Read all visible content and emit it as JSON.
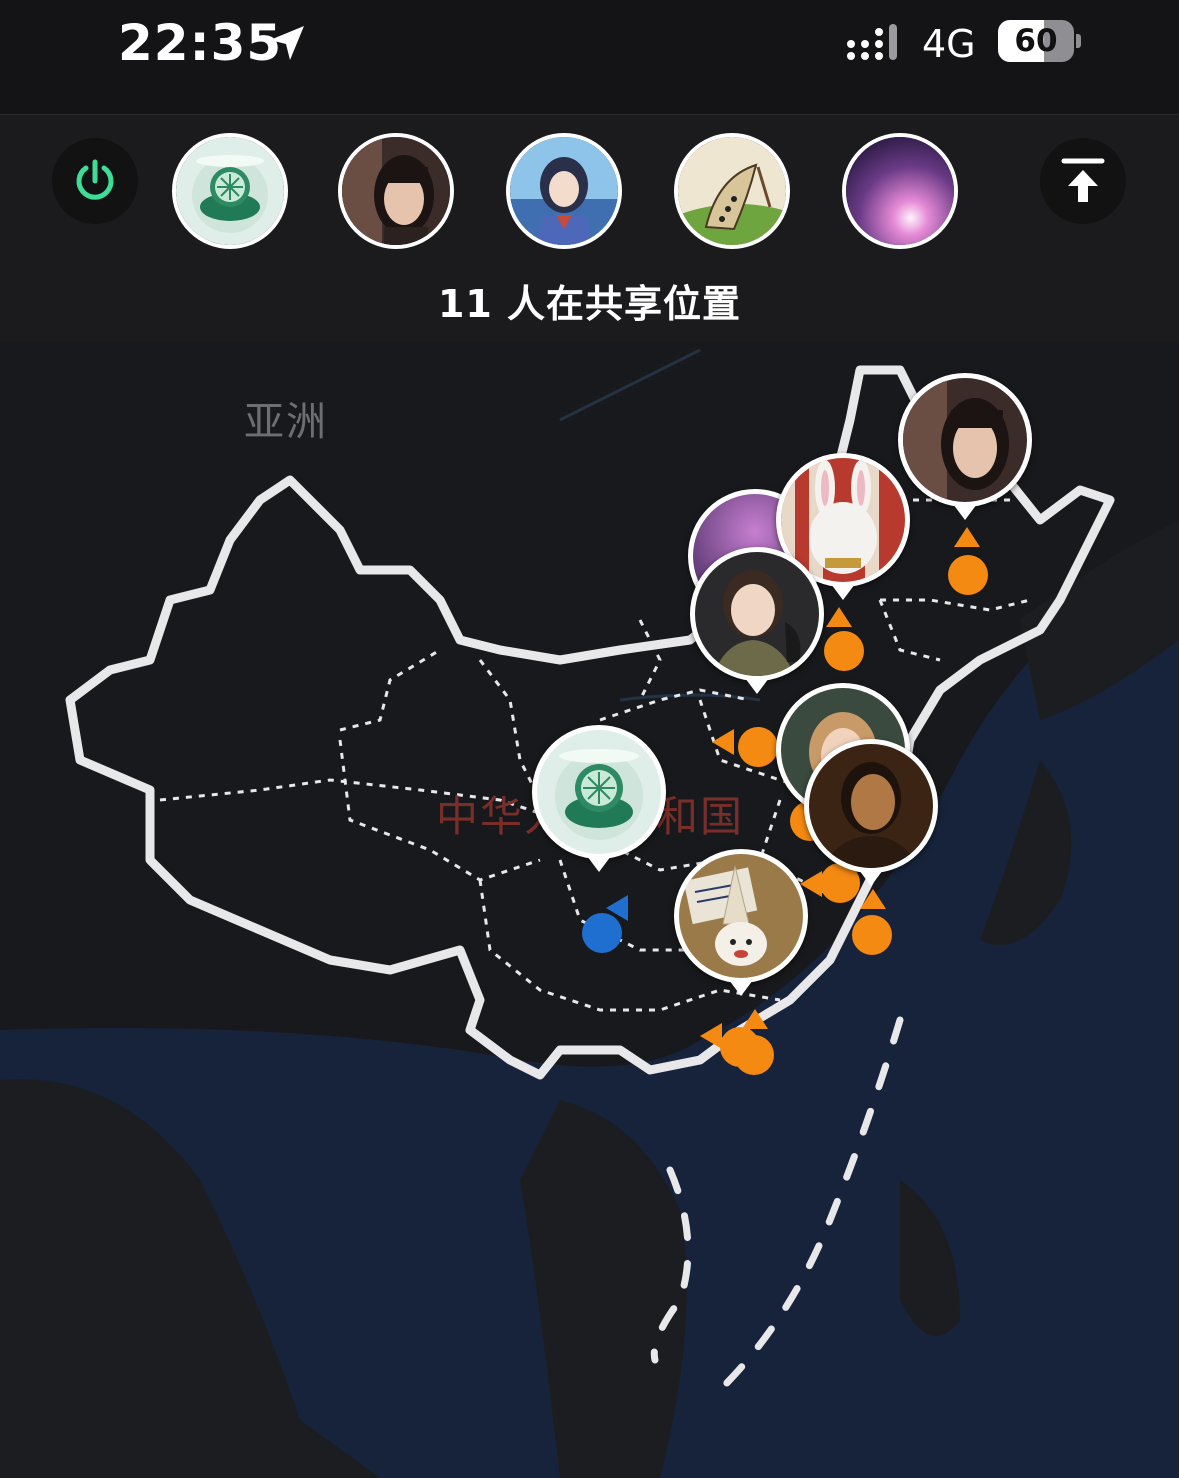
{
  "status_bar": {
    "time": "22:35",
    "network": "4G",
    "battery_percent": "60",
    "battery_level": 0.6
  },
  "share_panel": {
    "count_label": "11 人在共享位置",
    "power_icon": "power-icon",
    "collapse_icon": "collapse-to-top-icon",
    "accent_color": "#3ddc97"
  },
  "map": {
    "continent_label": "亚洲",
    "country_label": "中华人民共和国"
  },
  "colors": {
    "marker_orange": "#f58a12",
    "marker_blue": "#1f6fd1",
    "country_label": "#7a2e2a"
  }
}
